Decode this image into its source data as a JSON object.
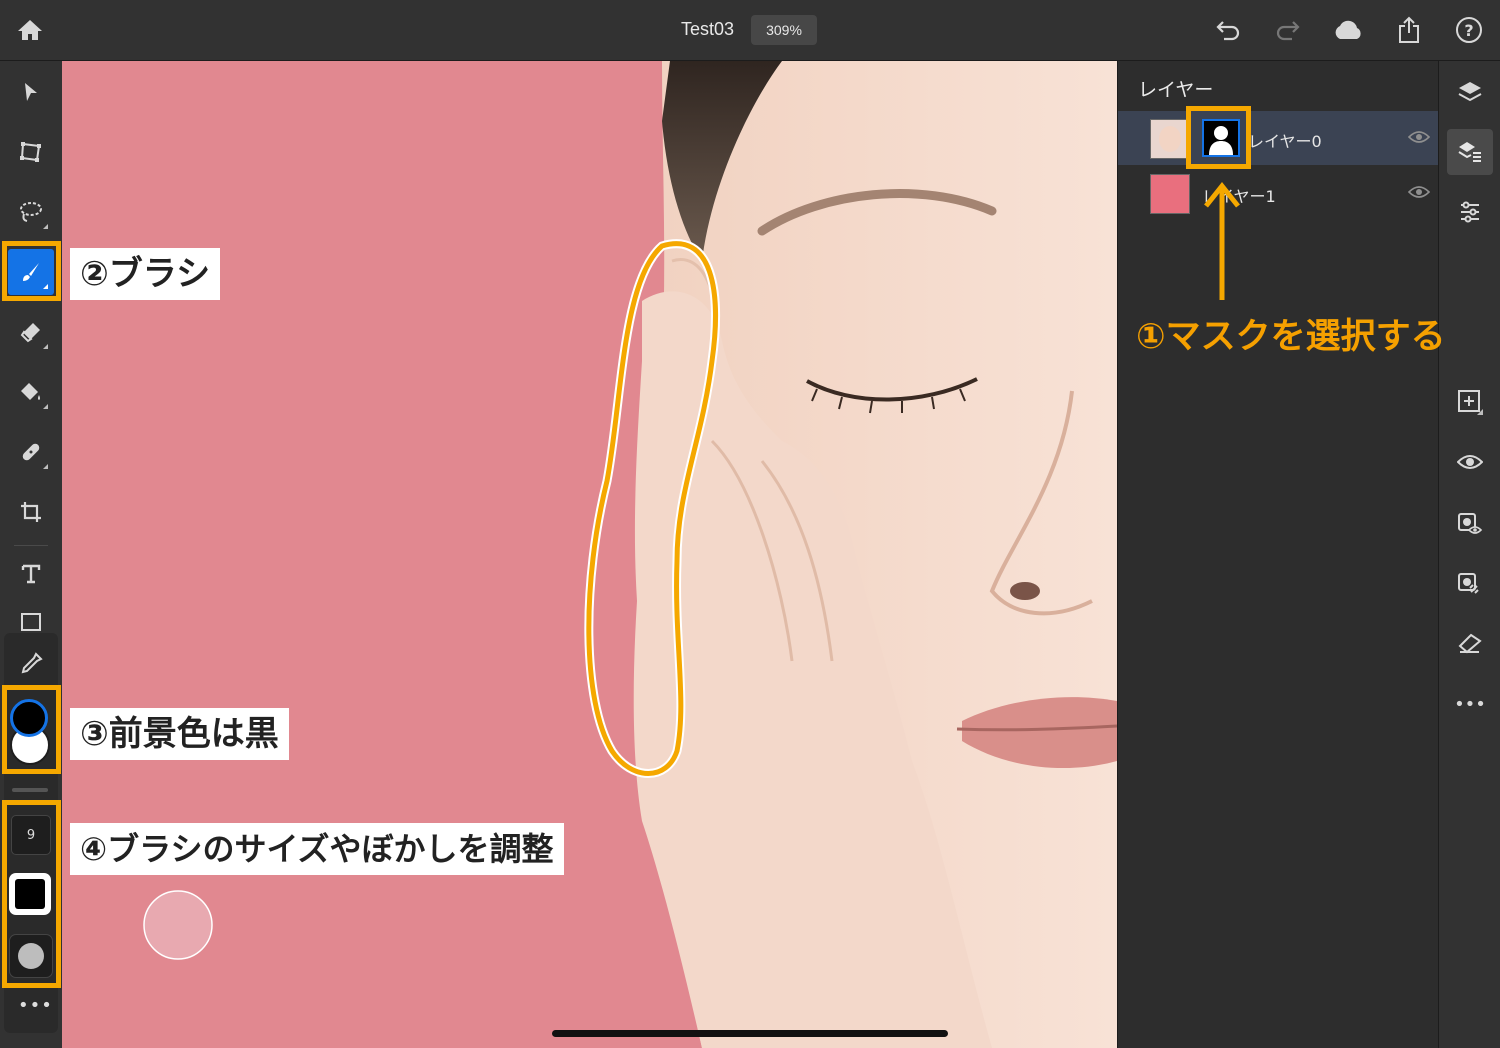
{
  "header": {
    "doc_title": "Test03",
    "zoom": "309%",
    "icons": [
      "home-icon",
      "undo-icon",
      "redo-icon",
      "cloud-icon",
      "share-icon",
      "help-icon"
    ]
  },
  "toolbar": {
    "tools": [
      "select-icon",
      "transform-icon",
      "lasso-icon",
      "brush-icon",
      "eraser-icon",
      "paint-bucket-icon",
      "healing-icon",
      "crop-icon",
      "type-icon",
      "place-image-icon",
      "eyedropper-icon"
    ],
    "active_tool": "brush-icon",
    "brush_size": "9",
    "foreground_color": "#000000",
    "background_color": "#ffffff"
  },
  "layers_panel": {
    "title": "レイヤー",
    "layers": [
      {
        "name": "レイヤー0",
        "selected": true
      },
      {
        "name": "レイヤー1",
        "selected": false
      }
    ]
  },
  "right_rail": {
    "icons": [
      "layers-icon",
      "layer-properties-icon",
      "adjustments-icon",
      "add-layer-icon",
      "visibility-icon",
      "mask-visibility-icon",
      "link-mask-icon",
      "clear-mask-icon",
      "more-icon"
    ]
  },
  "annotations": {
    "step1": "①マスクを選択する",
    "step2": "②ブラシ",
    "step3": "③前景色は黒",
    "step4": "④ブラシのサイズやぼかしを調整"
  },
  "colors": {
    "accent": "#1473e6",
    "highlight": "#f5a800",
    "canvas_bg": "#e18890"
  }
}
